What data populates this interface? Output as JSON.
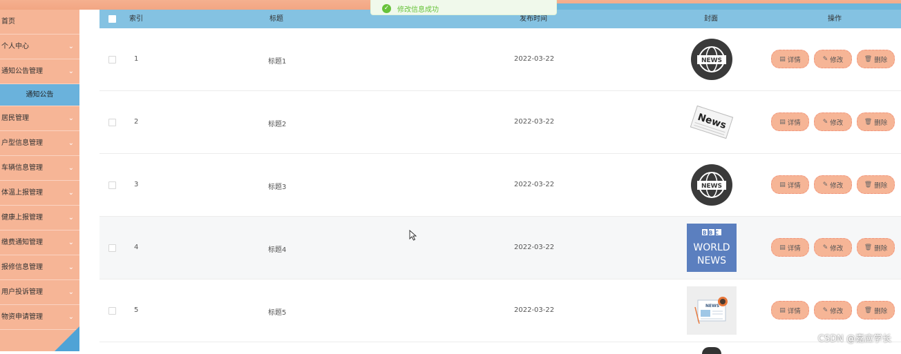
{
  "sidebar": {
    "items": [
      {
        "label": "首页",
        "has_arrow": false
      },
      {
        "label": "个人中心",
        "has_arrow": true
      },
      {
        "label": "通知公告管理",
        "has_arrow": true
      },
      {
        "label": "通知公告",
        "sub": true
      },
      {
        "label": "居民管理",
        "has_arrow": true
      },
      {
        "label": "户型信息管理",
        "has_arrow": true
      },
      {
        "label": "车辆信息管理",
        "has_arrow": true
      },
      {
        "label": "体温上报管理",
        "has_arrow": true
      },
      {
        "label": "健康上报管理",
        "has_arrow": true
      },
      {
        "label": "缴费通知管理",
        "has_arrow": true
      },
      {
        "label": "报修信息管理",
        "has_arrow": true
      },
      {
        "label": "用户投诉管理",
        "has_arrow": true
      },
      {
        "label": "物资申请管理",
        "has_arrow": true
      }
    ],
    "chevron": "⌄"
  },
  "table": {
    "headers": {
      "index": "索引",
      "title": "标题",
      "date": "发布时间",
      "cover": "封面",
      "ops": "操作"
    },
    "rows": [
      {
        "index": "1",
        "title": "标题1",
        "date": "2022-03-22",
        "cover": "globe-news"
      },
      {
        "index": "2",
        "title": "标题2",
        "date": "2022-03-22",
        "cover": "newspaper-news"
      },
      {
        "index": "3",
        "title": "标题3",
        "date": "2022-03-22",
        "cover": "globe-news"
      },
      {
        "index": "4",
        "title": "标题4",
        "date": "2022-03-22",
        "cover": "bbc-world-news"
      },
      {
        "index": "5",
        "title": "标题5",
        "date": "2022-03-22",
        "cover": "news-illustration"
      }
    ],
    "buttons": {
      "detail": "详情",
      "edit": "修改",
      "delete": "删除"
    }
  },
  "covers": {
    "globe_text": "NEWS",
    "paper_text": "News",
    "bbc_line1": "BBC",
    "bbc_line2": "WORLD",
    "bbc_line3": "NEWS",
    "illus_text": "NEWS"
  },
  "toast": {
    "message": "修改信息成功",
    "icon": "check-circle-icon"
  },
  "watermark": "CSDN @嘉应学长",
  "colors": {
    "sidebar": "#f6b596",
    "header": "#84c2e2",
    "active": "#6ab2dc",
    "button": "#f6b596",
    "success": "#67c23a"
  }
}
